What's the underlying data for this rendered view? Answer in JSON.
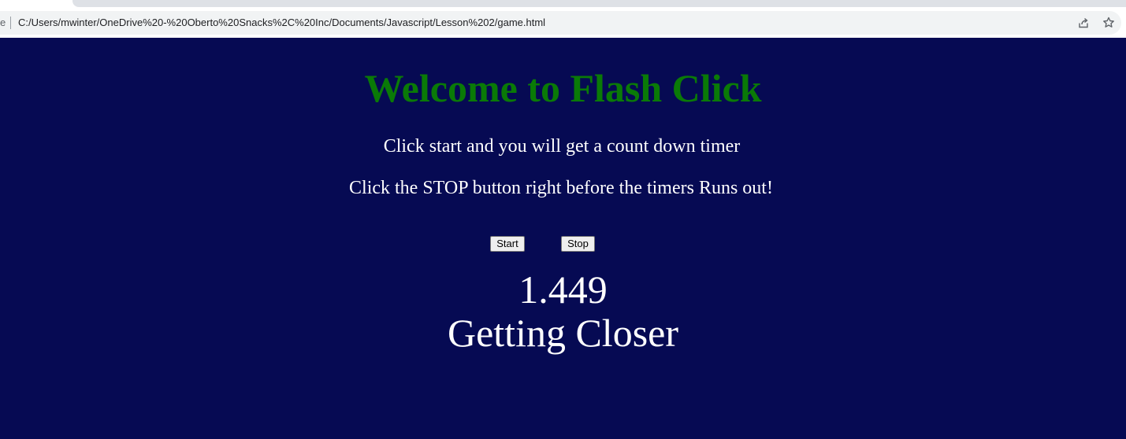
{
  "browser": {
    "site_info_tail": "e",
    "url": "C:/Users/mwinter/OneDrive%20-%20Oberto%20Snacks%2C%20Inc/Documents/Javascript/Lesson%202/game.html",
    "icons": [
      "share-icon",
      "bookmark-star-icon"
    ]
  },
  "page": {
    "title": "Welcome to Flash Click",
    "instructions": [
      "Click start and you will get a count down timer",
      "Click the STOP button right before the timers Runs out!"
    ],
    "buttons": {
      "start": "Start",
      "stop": "Stop"
    },
    "timer": "1.449",
    "status": "Getting Closer"
  },
  "colors": {
    "page_background": "#060a53",
    "title": "#0a7a07",
    "text": "#ffffff"
  }
}
